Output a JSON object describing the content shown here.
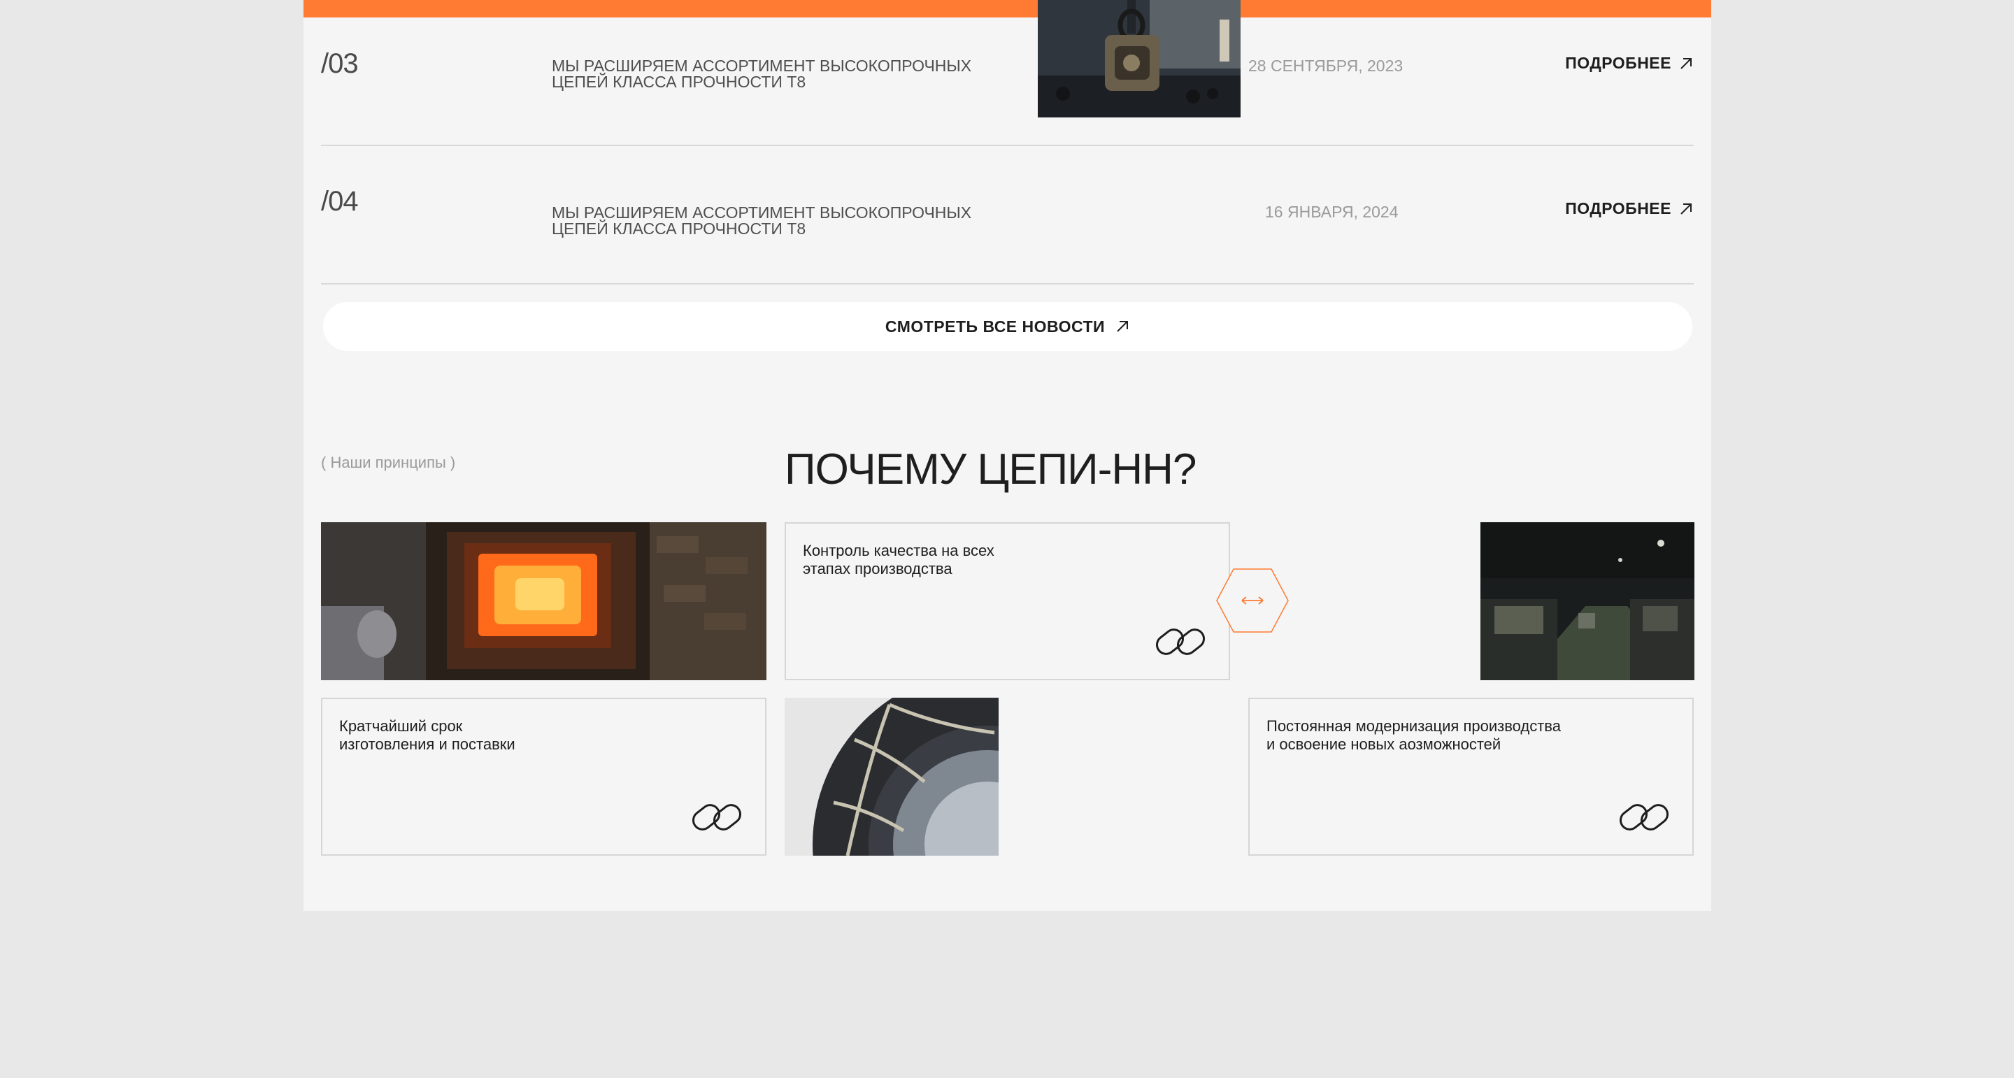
{
  "news": [
    {
      "number": "/03",
      "title": "МЫ РАСШИРЯЕМ АССОРТИМЕНТ ВЫСОКОПРОЧНЫХ ЦЕПЕЙ КЛАССА ПРОЧНОСТИ Т8",
      "date": "28 СЕНТЯБРЯ, 2023",
      "more_label": "ПОДРОБНЕЕ"
    },
    {
      "number": "/04",
      "title": "МЫ РАСШИРЯЕМ АССОРТИМЕНТ ВЫСОКОПРОЧНЫХ ЦЕПЕЙ КЛАССА ПРОЧНОСТИ Т8",
      "date": "16 ЯНВАРЯ, 2024",
      "more_label": "ПОДРОБНЕЕ"
    }
  ],
  "all_news_label": "СМОТРЕТЬ ВСЕ НОВОСТИ",
  "principles": {
    "label": "( Наши принципы )",
    "title": "ПОЧЕМУ ЦЕПИ-НН?",
    "cards": [
      {
        "text": "Контроль качества на всех\nэтапах производства"
      },
      {
        "text": "Кратчайший срок\nизготовления и поставки"
      },
      {
        "text": "Постоянная модернизация производства\nи освоение новых аозможностей"
      }
    ],
    "swap_icon": "↔"
  },
  "colors": {
    "accent": "#ff7a32",
    "page_bg": "#f5f5f5",
    "outer_bg": "#e8e8e8"
  },
  "icons": [
    "arrow-up-right-icon",
    "chain-link-icon",
    "swap-arrows-icon"
  ]
}
